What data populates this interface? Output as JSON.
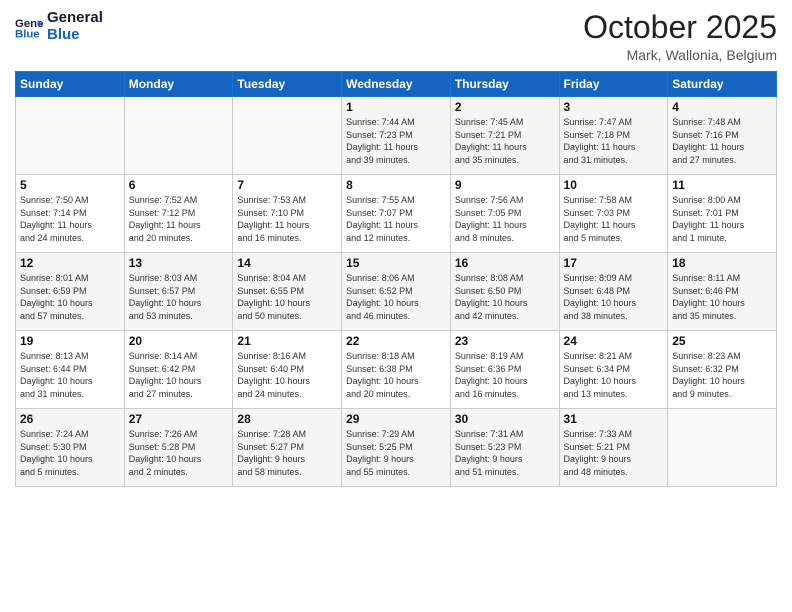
{
  "logo": {
    "line1": "General",
    "line2": "Blue"
  },
  "title": "October 2025",
  "subtitle": "Mark, Wallonia, Belgium",
  "days_of_week": [
    "Sunday",
    "Monday",
    "Tuesday",
    "Wednesday",
    "Thursday",
    "Friday",
    "Saturday"
  ],
  "weeks": [
    [
      {
        "day": "",
        "info": ""
      },
      {
        "day": "",
        "info": ""
      },
      {
        "day": "",
        "info": ""
      },
      {
        "day": "1",
        "info": "Sunrise: 7:44 AM\nSunset: 7:23 PM\nDaylight: 11 hours\nand 39 minutes."
      },
      {
        "day": "2",
        "info": "Sunrise: 7:45 AM\nSunset: 7:21 PM\nDaylight: 11 hours\nand 35 minutes."
      },
      {
        "day": "3",
        "info": "Sunrise: 7:47 AM\nSunset: 7:18 PM\nDaylight: 11 hours\nand 31 minutes."
      },
      {
        "day": "4",
        "info": "Sunrise: 7:48 AM\nSunset: 7:16 PM\nDaylight: 11 hours\nand 27 minutes."
      }
    ],
    [
      {
        "day": "5",
        "info": "Sunrise: 7:50 AM\nSunset: 7:14 PM\nDaylight: 11 hours\nand 24 minutes."
      },
      {
        "day": "6",
        "info": "Sunrise: 7:52 AM\nSunset: 7:12 PM\nDaylight: 11 hours\nand 20 minutes."
      },
      {
        "day": "7",
        "info": "Sunrise: 7:53 AM\nSunset: 7:10 PM\nDaylight: 11 hours\nand 16 minutes."
      },
      {
        "day": "8",
        "info": "Sunrise: 7:55 AM\nSunset: 7:07 PM\nDaylight: 11 hours\nand 12 minutes."
      },
      {
        "day": "9",
        "info": "Sunrise: 7:56 AM\nSunset: 7:05 PM\nDaylight: 11 hours\nand 8 minutes."
      },
      {
        "day": "10",
        "info": "Sunrise: 7:58 AM\nSunset: 7:03 PM\nDaylight: 11 hours\nand 5 minutes."
      },
      {
        "day": "11",
        "info": "Sunrise: 8:00 AM\nSunset: 7:01 PM\nDaylight: 11 hours\nand 1 minute."
      }
    ],
    [
      {
        "day": "12",
        "info": "Sunrise: 8:01 AM\nSunset: 6:59 PM\nDaylight: 10 hours\nand 57 minutes."
      },
      {
        "day": "13",
        "info": "Sunrise: 8:03 AM\nSunset: 6:57 PM\nDaylight: 10 hours\nand 53 minutes."
      },
      {
        "day": "14",
        "info": "Sunrise: 8:04 AM\nSunset: 6:55 PM\nDaylight: 10 hours\nand 50 minutes."
      },
      {
        "day": "15",
        "info": "Sunrise: 8:06 AM\nSunset: 6:52 PM\nDaylight: 10 hours\nand 46 minutes."
      },
      {
        "day": "16",
        "info": "Sunrise: 8:08 AM\nSunset: 6:50 PM\nDaylight: 10 hours\nand 42 minutes."
      },
      {
        "day": "17",
        "info": "Sunrise: 8:09 AM\nSunset: 6:48 PM\nDaylight: 10 hours\nand 38 minutes."
      },
      {
        "day": "18",
        "info": "Sunrise: 8:11 AM\nSunset: 6:46 PM\nDaylight: 10 hours\nand 35 minutes."
      }
    ],
    [
      {
        "day": "19",
        "info": "Sunrise: 8:13 AM\nSunset: 6:44 PM\nDaylight: 10 hours\nand 31 minutes."
      },
      {
        "day": "20",
        "info": "Sunrise: 8:14 AM\nSunset: 6:42 PM\nDaylight: 10 hours\nand 27 minutes."
      },
      {
        "day": "21",
        "info": "Sunrise: 8:16 AM\nSunset: 6:40 PM\nDaylight: 10 hours\nand 24 minutes."
      },
      {
        "day": "22",
        "info": "Sunrise: 8:18 AM\nSunset: 6:38 PM\nDaylight: 10 hours\nand 20 minutes."
      },
      {
        "day": "23",
        "info": "Sunrise: 8:19 AM\nSunset: 6:36 PM\nDaylight: 10 hours\nand 16 minutes."
      },
      {
        "day": "24",
        "info": "Sunrise: 8:21 AM\nSunset: 6:34 PM\nDaylight: 10 hours\nand 13 minutes."
      },
      {
        "day": "25",
        "info": "Sunrise: 8:23 AM\nSunset: 6:32 PM\nDaylight: 10 hours\nand 9 minutes."
      }
    ],
    [
      {
        "day": "26",
        "info": "Sunrise: 7:24 AM\nSunset: 5:30 PM\nDaylight: 10 hours\nand 5 minutes."
      },
      {
        "day": "27",
        "info": "Sunrise: 7:26 AM\nSunset: 5:28 PM\nDaylight: 10 hours\nand 2 minutes."
      },
      {
        "day": "28",
        "info": "Sunrise: 7:28 AM\nSunset: 5:27 PM\nDaylight: 9 hours\nand 58 minutes."
      },
      {
        "day": "29",
        "info": "Sunrise: 7:29 AM\nSunset: 5:25 PM\nDaylight: 9 hours\nand 55 minutes."
      },
      {
        "day": "30",
        "info": "Sunrise: 7:31 AM\nSunset: 5:23 PM\nDaylight: 9 hours\nand 51 minutes."
      },
      {
        "day": "31",
        "info": "Sunrise: 7:33 AM\nSunset: 5:21 PM\nDaylight: 9 hours\nand 48 minutes."
      },
      {
        "day": "",
        "info": ""
      }
    ]
  ]
}
